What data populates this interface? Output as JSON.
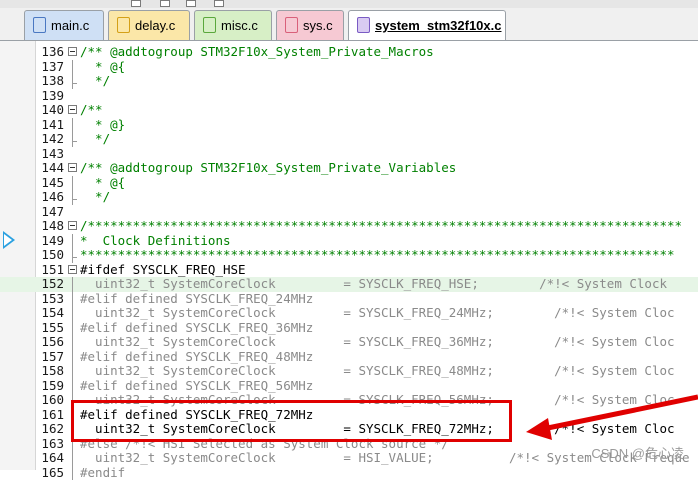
{
  "tabs": [
    {
      "label": "main.c",
      "color": "#cfe0f5",
      "icon_color": "#4a78c2",
      "active": false
    },
    {
      "label": "delay.c",
      "color": "#fbe7a8",
      "icon_color": "#d4a017",
      "active": false
    },
    {
      "label": "misc.c",
      "color": "#d7efc6",
      "icon_color": "#5aa83c",
      "active": false
    },
    {
      "label": "sys.c",
      "color": "#f6c9d3",
      "icon_color": "#d9607a",
      "active": false
    },
    {
      "label": "system_stm32f10x.c",
      "color": "#d9cbf2",
      "icon_color": "#7a5bc4",
      "active": true
    }
  ],
  "editor": {
    "lines": [
      {
        "num": "136",
        "fold": "open",
        "text": "/** @addtogroup STM32F10x_System_Private_Macros",
        "style": "comment"
      },
      {
        "num": "137",
        "fold": "bar",
        "text": "  * @{",
        "style": "comment"
      },
      {
        "num": "138",
        "fold": "end",
        "text": "  */",
        "style": "comment"
      },
      {
        "num": "139",
        "fold": "none",
        "text": "",
        "style": "plain"
      },
      {
        "num": "140",
        "fold": "open",
        "text": "/**",
        "style": "comment"
      },
      {
        "num": "141",
        "fold": "bar",
        "text": "  * @}",
        "style": "comment"
      },
      {
        "num": "142",
        "fold": "end",
        "text": "  */",
        "style": "comment"
      },
      {
        "num": "143",
        "fold": "none",
        "text": "",
        "style": "plain"
      },
      {
        "num": "144",
        "fold": "open",
        "text": "/** @addtogroup STM32F10x_System_Private_Variables",
        "style": "comment"
      },
      {
        "num": "145",
        "fold": "bar",
        "text": "  * @{",
        "style": "comment"
      },
      {
        "num": "146",
        "fold": "end",
        "text": "  */",
        "style": "comment"
      },
      {
        "num": "147",
        "fold": "none",
        "text": "",
        "style": "plain"
      },
      {
        "num": "148",
        "fold": "open",
        "text": "/*******************************************************************************",
        "style": "comment"
      },
      {
        "num": "149",
        "fold": "bar",
        "text": "*  Clock Definitions",
        "style": "comment"
      },
      {
        "num": "150",
        "fold": "end",
        "text": "*******************************************************************************",
        "style": "comment"
      },
      {
        "num": "151",
        "fold": "open",
        "text": "#ifdef SYSCLK_FREQ_HSE",
        "style": "black"
      },
      {
        "num": "152",
        "fold": "bar",
        "text": "  uint32_t SystemCoreClock         = SYSCLK_FREQ_HSE;        /*!< System Clock",
        "style": "dim",
        "highlight": true
      },
      {
        "num": "153",
        "fold": "bar",
        "text": "#elif defined SYSCLK_FREQ_24MHz",
        "style": "dim"
      },
      {
        "num": "154",
        "fold": "bar",
        "text": "  uint32_t SystemCoreClock         = SYSCLK_FREQ_24MHz;        /*!< System Cloc",
        "style": "dim"
      },
      {
        "num": "155",
        "fold": "bar",
        "text": "#elif defined SYSCLK_FREQ_36MHz",
        "style": "dim"
      },
      {
        "num": "156",
        "fold": "bar",
        "text": "  uint32_t SystemCoreClock         = SYSCLK_FREQ_36MHz;        /*!< System Cloc",
        "style": "dim"
      },
      {
        "num": "157",
        "fold": "bar",
        "text": "#elif defined SYSCLK_FREQ_48MHz",
        "style": "dim"
      },
      {
        "num": "158",
        "fold": "bar",
        "text": "  uint32_t SystemCoreClock         = SYSCLK_FREQ_48MHz;        /*!< System Cloc",
        "style": "dim"
      },
      {
        "num": "159",
        "fold": "bar",
        "text": "#elif defined SYSCLK_FREQ_56MHz",
        "style": "dim"
      },
      {
        "num": "160",
        "fold": "bar",
        "text": "  uint32_t SystemCoreClock         = SYSCLK_FREQ_56MHz;        /*!< System Cloc",
        "style": "dim"
      },
      {
        "num": "161",
        "fold": "bar",
        "text": "#elif defined SYSCLK_FREQ_72MHz",
        "style": "black"
      },
      {
        "num": "162",
        "fold": "bar",
        "text": "  uint32_t SystemCoreClock         = SYSCLK_FREQ_72MHz;        /*!< System Cloc",
        "style": "black"
      },
      {
        "num": "163",
        "fold": "bar",
        "text": "#else /*!< HSI Selected as System Clock source */",
        "style": "dim"
      },
      {
        "num": "164",
        "fold": "bar",
        "text": "  uint32_t SystemCoreClock         = HSI_VALUE;          /*!< System Clock Freque",
        "style": "dim"
      },
      {
        "num": "165",
        "fold": "bar",
        "text": "#endif",
        "style": "dim"
      }
    ]
  },
  "annotation": {
    "color": "#e00000"
  },
  "watermark": "CSDN @危心凌"
}
